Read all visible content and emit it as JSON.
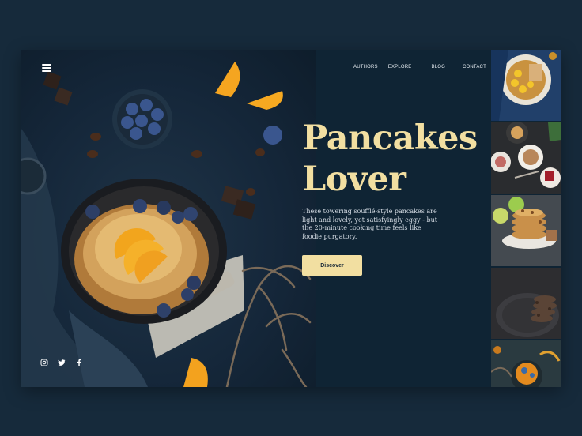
{
  "nav": {
    "items": [
      "AUTHORS",
      "EXPLORE",
      "BLOG",
      "CONTACT"
    ]
  },
  "hero": {
    "title_line1": "Pancakes",
    "title_line2": "Lover",
    "description": "These towering soufflé-style pancakes are light and lovely, yet satisfyingly eggy - but the 20-minute cooking time feels like foodie purgatory.",
    "cta_label": "Discover"
  },
  "socials": [
    "instagram-icon",
    "twitter-icon",
    "facebook-icon"
  ],
  "thumbnails": [
    "pancake-plate-thumb",
    "coffee-table-thumb",
    "pancake-stack-thumb",
    "dark-plate-thumb",
    "orange-dessert-thumb"
  ],
  "colors": {
    "accent": "#f2dfa1",
    "panel": "#0f2434",
    "page": "#162a3b"
  }
}
